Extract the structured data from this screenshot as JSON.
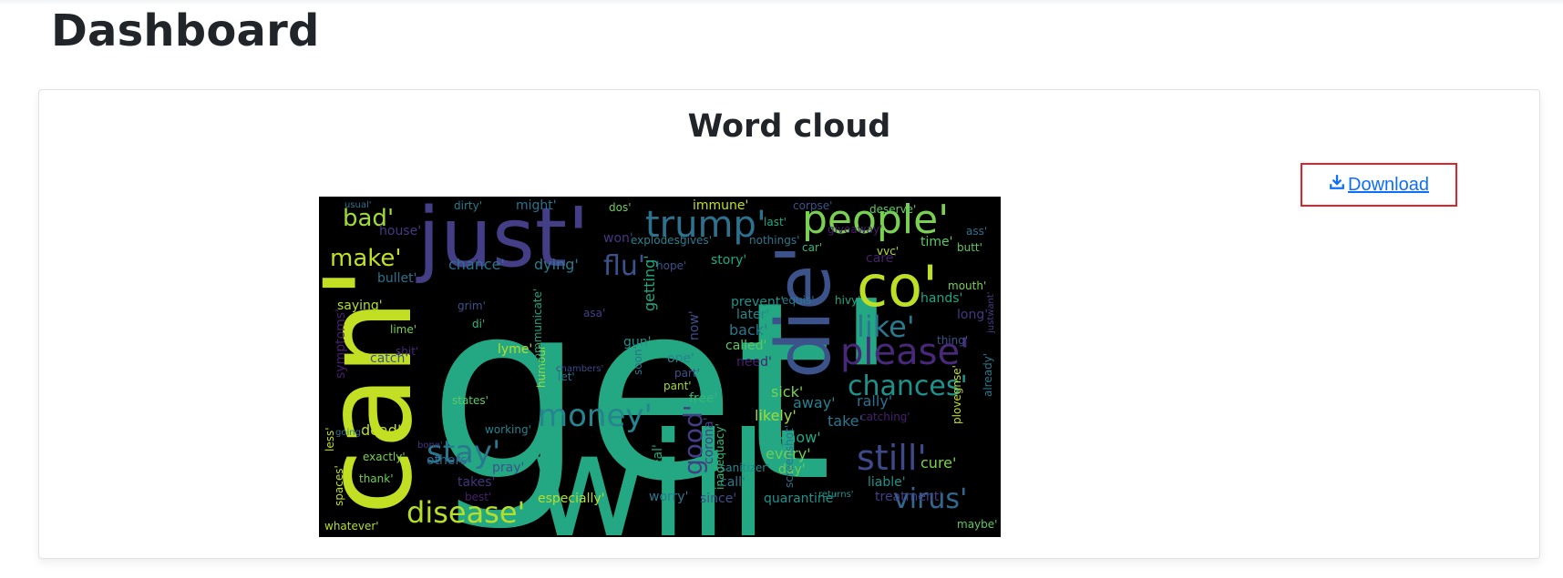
{
  "page": {
    "title": "Dashboard"
  },
  "card": {
    "title": "Word cloud",
    "download_label": "Download",
    "download_icon": "download-icon"
  },
  "wordcloud": {
    "background": "#000000",
    "words": [
      {
        "text": "get'",
        "color": "#23a883"
      },
      {
        "text": "will'",
        "color": "#23a883"
      },
      {
        "text": "can'",
        "color": "#c2df23"
      },
      {
        "text": "just'",
        "color": "#433e85"
      },
      {
        "text": "die'",
        "color": "#3b528b"
      },
      {
        "text": "co'",
        "color": "#bddf26"
      },
      {
        "text": "people'",
        "color": "#7ad151"
      },
      {
        "text": "trump'",
        "color": "#2c728e"
      },
      {
        "text": "please'",
        "color": "#482878"
      },
      {
        "text": "still'",
        "color": "#3e4989"
      },
      {
        "text": "stay'",
        "color": "#2a788e"
      },
      {
        "text": "money'",
        "color": "#25848e"
      },
      {
        "text": "disease'",
        "color": "#b5de2b"
      },
      {
        "text": "virus'",
        "color": "#31688e"
      },
      {
        "text": "chances'",
        "color": "#20928c"
      },
      {
        "text": "like'",
        "color": "#2a788e"
      },
      {
        "text": "flu'",
        "color": "#3b528b"
      },
      {
        "text": "bad'",
        "color": "#a0da39"
      },
      {
        "text": "make'",
        "color": "#c2df23"
      },
      {
        "text": "good'",
        "color": "#433e85"
      },
      {
        "text": "house'",
        "color": "#443a83"
      },
      {
        "text": "chance'",
        "color": "#2c728e"
      },
      {
        "text": "dying'",
        "color": "#287c8e"
      },
      {
        "text": "hope'",
        "color": "#3b528b"
      },
      {
        "text": "story'",
        "color": "#22a884"
      },
      {
        "text": "car'",
        "color": "#35b779"
      },
      {
        "text": "time'",
        "color": "#5ec962"
      },
      {
        "text": "care'",
        "color": "#481f70"
      },
      {
        "text": "hands'",
        "color": "#20a486"
      },
      {
        "text": "long'",
        "color": "#453781"
      },
      {
        "text": "saying'",
        "color": "#b5de2b"
      },
      {
        "text": "back'",
        "color": "#2a788e"
      },
      {
        "text": "rally'",
        "color": "#2c728e"
      },
      {
        "text": "sick'",
        "color": "#7ad151"
      },
      {
        "text": "away'",
        "color": "#26828e"
      },
      {
        "text": "likely'",
        "color": "#a0da39"
      },
      {
        "text": "know'",
        "color": "#22a884"
      },
      {
        "text": "every'",
        "color": "#6ece58"
      },
      {
        "text": "take'",
        "color": "#2a788e"
      },
      {
        "text": "cure'",
        "color": "#7ad151"
      },
      {
        "text": "dead'",
        "color": "#c2df23"
      },
      {
        "text": "pray'",
        "color": "#3b528b"
      },
      {
        "text": "takes'",
        "color": "#46327e"
      },
      {
        "text": "others'",
        "color": "#31688e"
      },
      {
        "text": "especially'",
        "color": "#b5de2b"
      },
      {
        "text": "worry'",
        "color": "#2a788e"
      },
      {
        "text": "since'",
        "color": "#3b528b"
      },
      {
        "text": "quarantine'",
        "color": "#20928c"
      },
      {
        "text": "treatment'",
        "color": "#433e85"
      },
      {
        "text": "immune'",
        "color": "#c2df23"
      },
      {
        "text": "dirty'",
        "color": "#287c8e"
      },
      {
        "text": "might'",
        "color": "#2c728e"
      },
      {
        "text": "lyme'",
        "color": "#b5de2b"
      },
      {
        "text": "gun'",
        "color": "#20928c"
      },
      {
        "text": "one'",
        "color": "#25848e"
      },
      {
        "text": "let'",
        "color": "#2c728e"
      },
      {
        "text": "free'",
        "color": "#35b779"
      },
      {
        "text": "getting'",
        "color": "#22a884"
      },
      {
        "text": "now'",
        "color": "#3b528b"
      },
      {
        "text": "called'",
        "color": "#5ec962"
      },
      {
        "text": "need'",
        "color": "#481f70"
      },
      {
        "text": "later'",
        "color": "#23898e"
      },
      {
        "text": "prevent'",
        "color": "#21918c"
      },
      {
        "text": "bullet'",
        "color": "#2c728e"
      },
      {
        "text": "catch'",
        "color": "#3b528b"
      },
      {
        "text": "symptoms'",
        "color": "#481f70"
      },
      {
        "text": "states'",
        "color": "#5ec962"
      },
      {
        "text": "less'",
        "color": "#c2df23"
      },
      {
        "text": "day'",
        "color": "#6ece58"
      },
      {
        "text": "call'",
        "color": "#2a788e"
      },
      {
        "text": "heal'",
        "color": "#22a884"
      },
      {
        "text": "corona'",
        "color": "#433e85"
      },
      {
        "text": "sanitizer'",
        "color": "#23898e"
      },
      {
        "text": "liable'",
        "color": "#20928c"
      },
      {
        "text": "thing'",
        "color": "#3b528b"
      },
      {
        "text": "mouth'",
        "color": "#7ad151"
      },
      {
        "text": "butt'",
        "color": "#5ec962"
      },
      {
        "text": "ass'",
        "color": "#2c728e"
      },
      {
        "text": "vvc'",
        "color": "#b5de2b"
      },
      {
        "text": "last'",
        "color": "#22a884"
      },
      {
        "text": "won'",
        "color": "#453781"
      },
      {
        "text": "explodes'",
        "color": "#26828e"
      },
      {
        "text": "gives'",
        "color": "#2a788e"
      },
      {
        "text": "humour'",
        "color": "#a0da39"
      },
      {
        "text": "asa'",
        "color": "#433e85"
      },
      {
        "text": "whatever'",
        "color": "#b5de2b"
      },
      {
        "text": "spaces'",
        "color": "#c2df23"
      },
      {
        "text": "thank'",
        "color": "#6ece58"
      },
      {
        "text": "exactly'",
        "color": "#7ad151"
      },
      {
        "text": "best'",
        "color": "#481f70"
      },
      {
        "text": "working'",
        "color": "#25848e"
      },
      {
        "text": "pant'",
        "color": "#a0da39"
      },
      {
        "text": "part'",
        "color": "#3b528b"
      },
      {
        "text": "inadequacy'",
        "color": "#35b779"
      },
      {
        "text": "screenshot'",
        "color": "#2c728e"
      },
      {
        "text": "catching'",
        "color": "#481f70"
      },
      {
        "text": "maybe'",
        "color": "#5ec962"
      },
      {
        "text": "excommunicate'",
        "color": "#20a486"
      },
      {
        "text": "soon'",
        "color": "#2c728e"
      },
      {
        "text": "lime'",
        "color": "#7ad151"
      },
      {
        "text": "shit'",
        "color": "#482878"
      },
      {
        "text": "grim'",
        "color": "#3b528b"
      },
      {
        "text": "usual'",
        "color": "#2c728e"
      },
      {
        "text": "dos'",
        "color": "#6ece58"
      },
      {
        "text": "deserve'",
        "color": "#5ec962"
      },
      {
        "text": "nothings'",
        "color": "#2a788e"
      },
      {
        "text": "corpse'",
        "color": "#3b528b"
      },
      {
        "text": "equis'",
        "color": "#2a788e"
      },
      {
        "text": "hivy'",
        "color": "#22a884"
      },
      {
        "text": "giveaway'",
        "color": "#481f70"
      },
      {
        "text": "di'",
        "color": "#35b779"
      },
      {
        "text": "bone'",
        "color": "#453781"
      },
      {
        "text": "going'",
        "color": "#2c728e"
      },
      {
        "text": "already'",
        "color": "#2a788e"
      },
      {
        "text": "plovegnse'",
        "color": "#c2df23"
      },
      {
        "text": "justwant'",
        "color": "#433e85"
      },
      {
        "text": "returns'",
        "color": "#20928c"
      },
      {
        "text": "chambers'",
        "color": "#3e4989"
      }
    ]
  }
}
